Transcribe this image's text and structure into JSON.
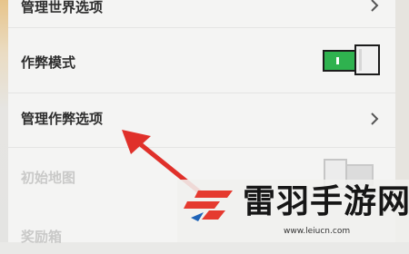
{
  "settings": {
    "rows": [
      {
        "label": "管理世界选项",
        "control": "chevron"
      },
      {
        "label": "作弊模式",
        "control": "toggle",
        "state": "on"
      },
      {
        "label": "管理作弊选项",
        "control": "chevron"
      },
      {
        "label": "初始地图",
        "control": "toggle",
        "state": "off",
        "disabled": true
      },
      {
        "label": "奖励箱",
        "disabled": true
      }
    ]
  },
  "watermark": {
    "brand": "雷羽手游网",
    "url": "www.leiucn.com"
  },
  "colors": {
    "toggle_on": "#2fb24f",
    "arrow": "#e0302a",
    "logo_red": "#e53a2f"
  }
}
